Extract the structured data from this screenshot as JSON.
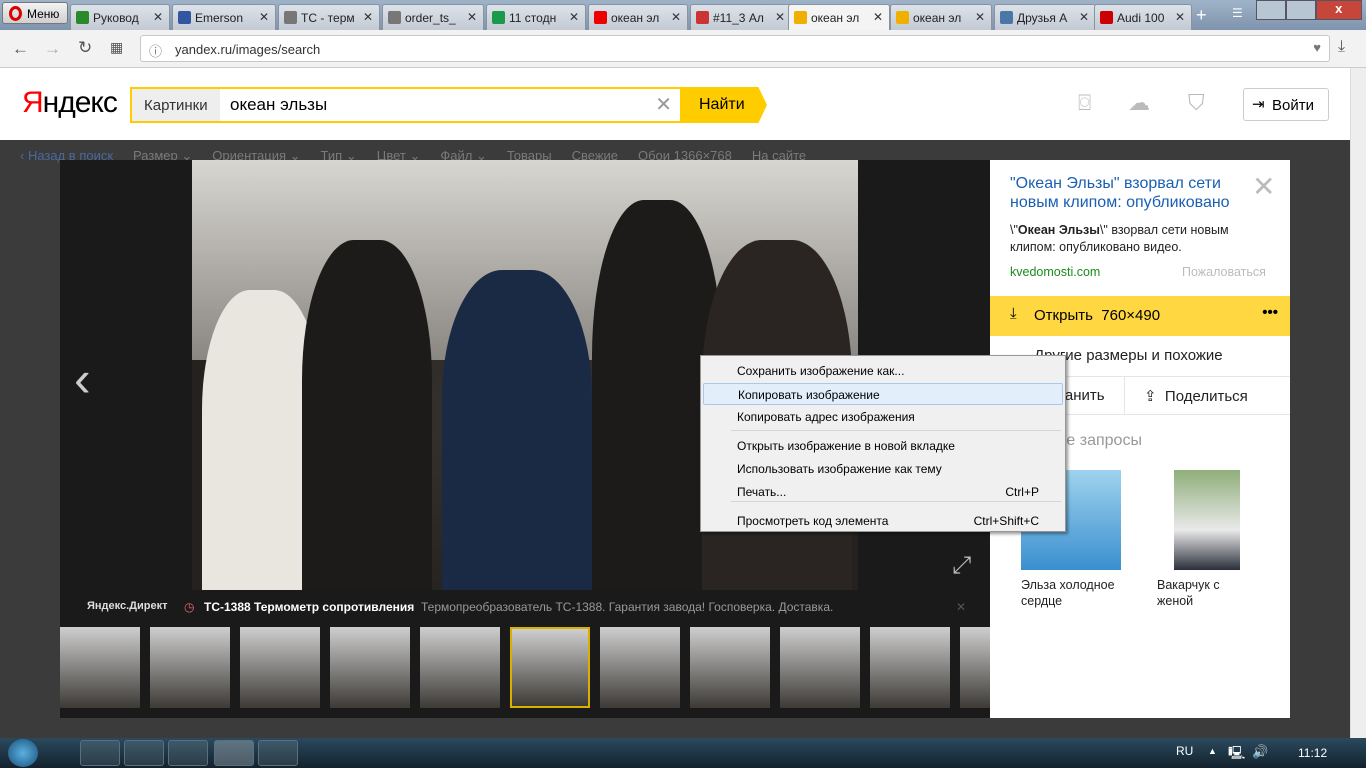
{
  "browser": {
    "menu_label": "Меню",
    "tabs": [
      {
        "label": "Руковод",
        "color": "#2a8a2a"
      },
      {
        "label": "Emerson",
        "color": "#3456a0"
      },
      {
        "label": "TC - терм",
        "color": "#777"
      },
      {
        "label": "order_ts_",
        "color": "#777"
      },
      {
        "label": "11 стодн",
        "color": "#1a9a4a"
      },
      {
        "label": "океан эл",
        "color": "#e00"
      },
      {
        "label": "#11_3 Ал",
        "color": "#c33"
      },
      {
        "label": "океан эл",
        "color": "#f0b000",
        "active": true
      },
      {
        "label": "океан эл",
        "color": "#f0b000"
      },
      {
        "label": "Друзья А",
        "color": "#4a76a8"
      },
      {
        "label": "Audi 100",
        "color": "#c00"
      }
    ],
    "url": "yandex.ru/images/search"
  },
  "header": {
    "logo": "Яндекс",
    "category": "Картинки",
    "query": "океан эльзы",
    "search_button": "Найти",
    "login_button": "Войти"
  },
  "filters": {
    "back": "‹ Назад в поиск",
    "items": [
      "Размер ⌄",
      "Ориентация ⌄",
      "Тип ⌄",
      "Цвет ⌄",
      "Файл ⌄",
      "Товары",
      "Свежие",
      "Обои 1366×768",
      "На сайте"
    ]
  },
  "ad": {
    "label": "Яндекс.Директ",
    "title": "ТС-1388 Термометр сопротивления",
    "text": "Термопреобразователь ТС-1388. Гарантия завода! Госповерка. Доставка."
  },
  "sidebar": {
    "title": "\"Океан Эльзы\" взорвал сети новым клипом: опубликовано",
    "desc_bold": "Океан Эльзы",
    "desc_pre": "\\\"",
    "desc_post": "\\\" взорвал сети новым клипом: опубликовано видео.",
    "source": "kvedomosti.com",
    "complain": "Пожаловаться",
    "open_label": "Открыть",
    "open_size": "760×490",
    "other_sizes": "Другие размеры и похожие",
    "save": "Сохранить",
    "share": "Поделиться",
    "related_title": "Похожие запросы",
    "related": [
      {
        "label": "Эльза холодное сердце"
      },
      {
        "label": "Вакарчук с женой"
      }
    ]
  },
  "context_menu": [
    {
      "label": "Сохранить изображение как..."
    },
    {
      "label": "Копировать изображение",
      "highlighted": true
    },
    {
      "label": "Копировать адрес изображения"
    },
    {
      "label": "Открыть изображение в новой вкладке"
    },
    {
      "label": "Использовать изображение как тему"
    },
    {
      "label": "Печать...",
      "shortcut": "Ctrl+P"
    },
    {
      "label": "Просмотреть код элемента",
      "shortcut": "Ctrl+Shift+C"
    }
  ],
  "taskbar": {
    "lang": "RU",
    "time": "11:12"
  },
  "colors": {
    "yandex_yellow": "#ffcc00",
    "link_blue": "#1a5fb4",
    "source_green": "#1b8a1b"
  }
}
